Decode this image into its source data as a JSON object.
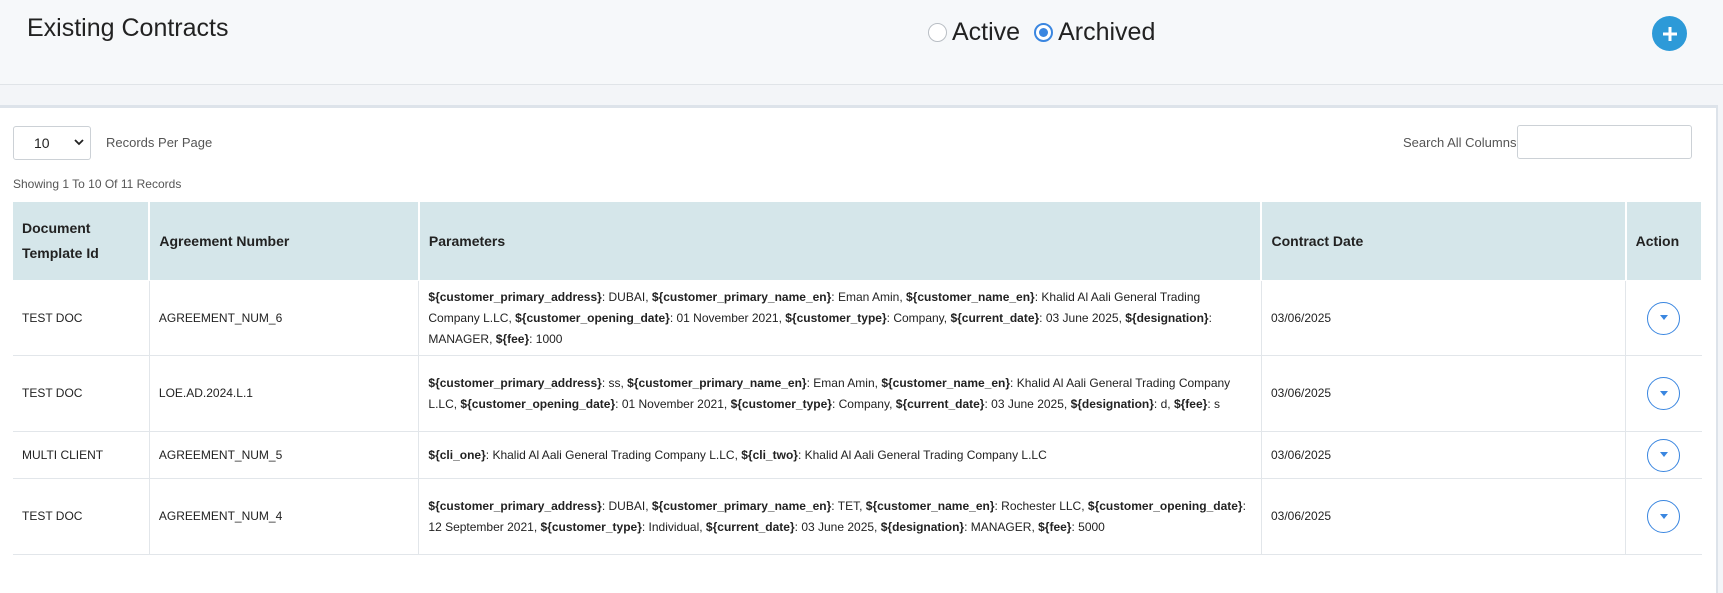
{
  "header": {
    "title": "Existing Contracts",
    "filter_options": [
      {
        "label": "Active",
        "checked": false
      },
      {
        "label": "Archived",
        "checked": true
      }
    ],
    "add_icon": "plus-icon"
  },
  "controls": {
    "per_page_value": "10",
    "per_page_label": "Records Per Page",
    "search_label": "Search All Columns",
    "search_value": "",
    "showing_text": "Showing 1 To 10 Of 11 Records"
  },
  "table": {
    "headers": [
      "Document Template Id",
      "Agreement Number",
      "Parameters",
      "Contract Date",
      "Action"
    ],
    "rows": [
      {
        "template_id": "TEST DOC",
        "agreement_number": "AGREEMENT_NUM_6",
        "params": [
          {
            "key": "${customer_primary_address}",
            "value": "DUBAI"
          },
          {
            "key": "${customer_primary_name_en}",
            "value": "Eman Amin"
          },
          {
            "key": "${customer_name_en}",
            "value": "Khalid Al Aali General Trading Company L.LC"
          },
          {
            "key": "${customer_opening_date}",
            "value": "01 November 2021"
          },
          {
            "key": "${customer_type}",
            "value": "Company"
          },
          {
            "key": "${current_date}",
            "value": "03 June 2025"
          },
          {
            "key": "${designation}",
            "value": "MANAGER"
          },
          {
            "key": "${fee}",
            "value": "1000"
          }
        ],
        "contract_date": "03/06/2025",
        "height": 75
      },
      {
        "template_id": "TEST DOC",
        "agreement_number": "LOE.AD.2024.L.1",
        "params": [
          {
            "key": "${customer_primary_address}",
            "value": "ss"
          },
          {
            "key": "${customer_primary_name_en}",
            "value": "Eman Amin"
          },
          {
            "key": "${customer_name_en}",
            "value": "Khalid Al Aali General Trading Company L.LC"
          },
          {
            "key": "${customer_opening_date}",
            "value": "01 November 2021"
          },
          {
            "key": "${customer_type}",
            "value": "Company"
          },
          {
            "key": "${current_date}",
            "value": "03 June 2025"
          },
          {
            "key": "${designation}",
            "value": "d"
          },
          {
            "key": "${fee}",
            "value": "s"
          }
        ],
        "contract_date": "03/06/2025",
        "height": 76
      },
      {
        "template_id": "MULTI CLIENT",
        "agreement_number": "AGREEMENT_NUM_5",
        "params": [
          {
            "key": "${cli_one}",
            "value": "Khalid Al Aali General Trading Company L.LC"
          },
          {
            "key": "${cli_two}",
            "value": "Khalid Al Aali General Trading Company L.LC"
          }
        ],
        "contract_date": "03/06/2025",
        "height": 47
      },
      {
        "template_id": "TEST DOC",
        "agreement_number": "AGREEMENT_NUM_4",
        "params": [
          {
            "key": "${customer_primary_address}",
            "value": "DUBAI"
          },
          {
            "key": "${customer_primary_name_en}",
            "value": "TET"
          },
          {
            "key": "${customer_name_en}",
            "value": "Rochester LLC"
          },
          {
            "key": "${customer_opening_date}",
            "value": "12 September 2021"
          },
          {
            "key": "${customer_type}",
            "value": "Individual"
          },
          {
            "key": "${current_date}",
            "value": "03 June 2025"
          },
          {
            "key": "${designation}",
            "value": "MANAGER"
          },
          {
            "key": "${fee}",
            "value": "5000"
          }
        ],
        "contract_date": "03/06/2025",
        "height": 76
      }
    ]
  },
  "colors": {
    "accent": "#2d9ad8",
    "header_bg": "#d5e6ea",
    "radio": "#3a86e0"
  }
}
